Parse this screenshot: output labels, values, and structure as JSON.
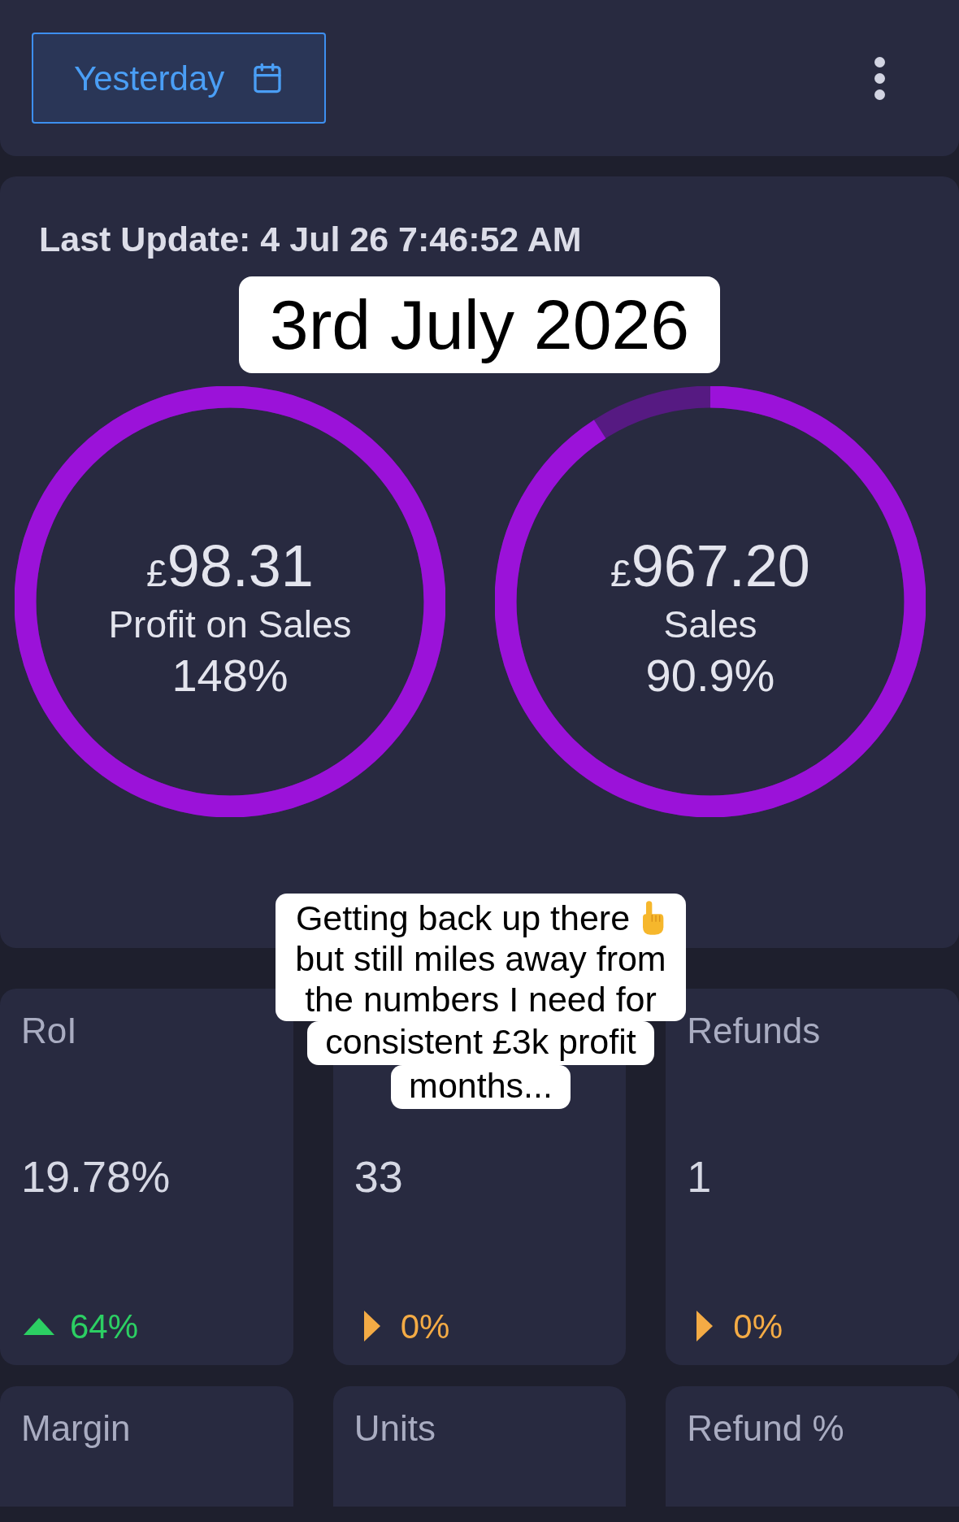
{
  "toolbar": {
    "date_button": "Yesterday"
  },
  "summary": {
    "last_update": "Last Update: 4 Jul 26 7:46:52 AM",
    "date_caption": "3rd July 2026",
    "rings": [
      {
        "currency": "£",
        "amount": "98.31",
        "label": "Profit on Sales",
        "percent": "148%",
        "level": 1
      },
      {
        "currency": "£",
        "amount": "967.20",
        "label": "Sales",
        "percent": "90.9%",
        "level": 0.909
      }
    ]
  },
  "stats": [
    {
      "title": "RoI",
      "value": "19.78%",
      "change": {
        "kind": "up",
        "text": "64%"
      }
    },
    {
      "value": "33",
      "change": {
        "kind": "flat",
        "text": "0%"
      }
    },
    {
      "title": "Refunds",
      "value": "1",
      "change": {
        "kind": "flat",
        "text": "0%"
      }
    },
    {
      "title": "Margin"
    },
    {
      "title": "Units"
    },
    {
      "title": "Refund %"
    }
  ],
  "caption": {
    "blocks": [
      [
        "Getting back up there",
        "but still miles away from",
        "the numbers I need for"
      ],
      [
        "consistent £3k profit"
      ],
      [
        "months..."
      ]
    ]
  }
}
